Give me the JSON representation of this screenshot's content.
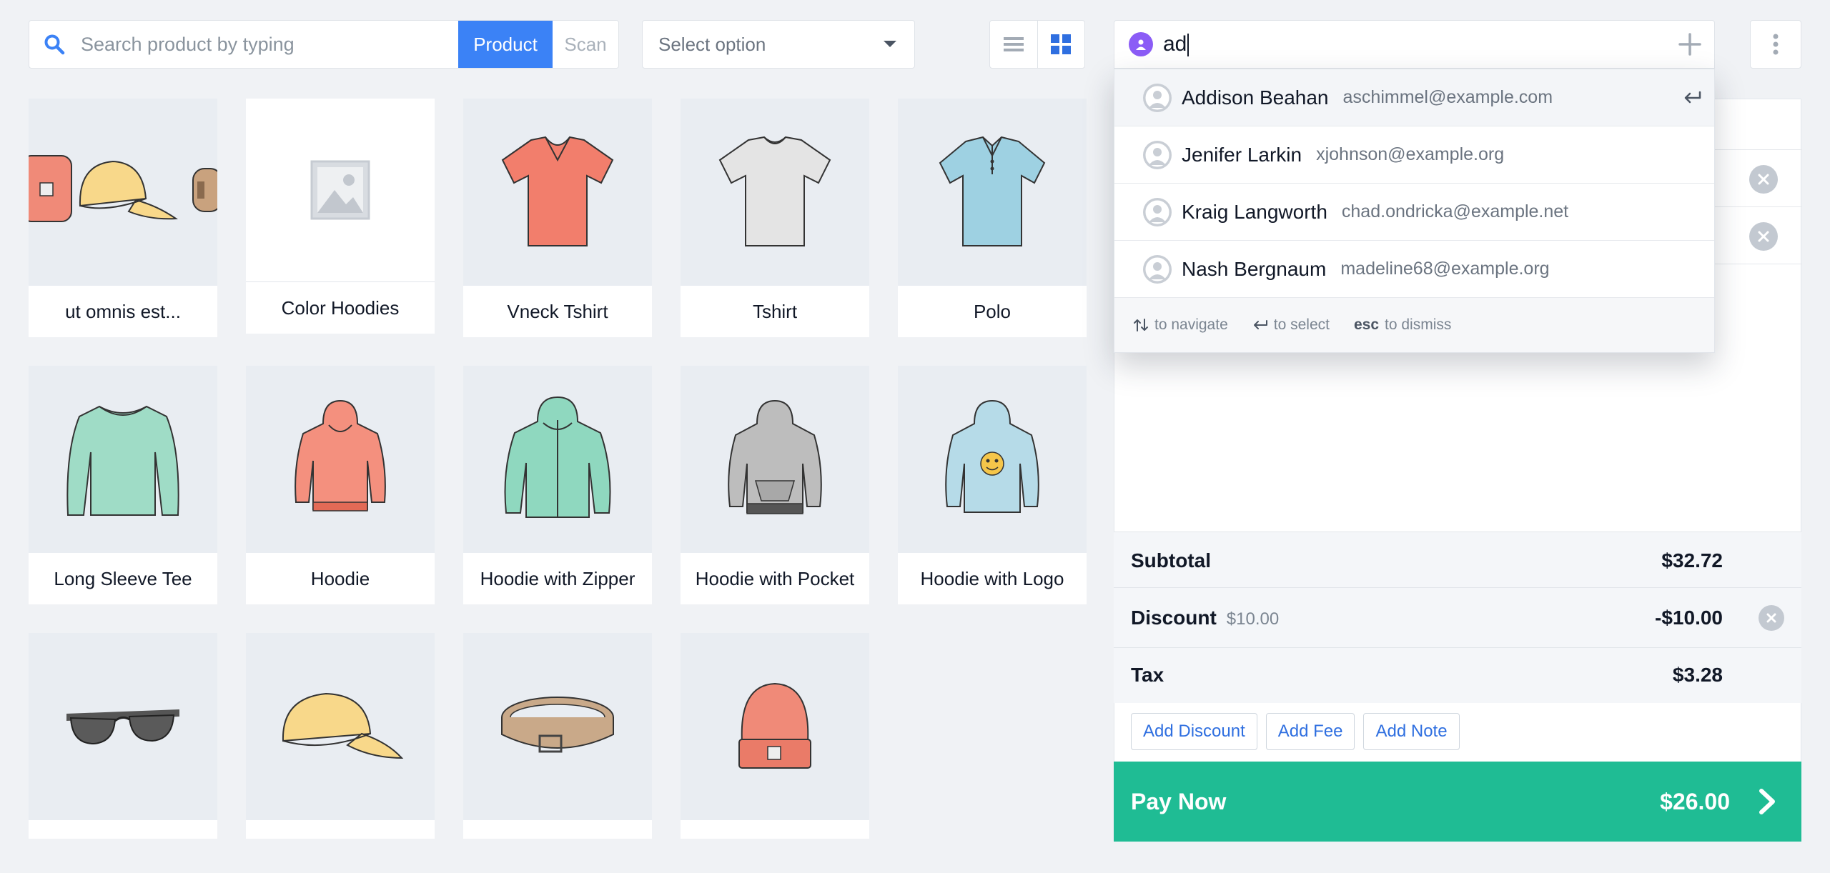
{
  "toolbar": {
    "search_placeholder": "Search product by typing",
    "product_label": "Product",
    "scan_label": "Scan",
    "select_label": "Select option"
  },
  "products": [
    {
      "name": "ut omnis est..."
    },
    {
      "name": "Color Hoodies"
    },
    {
      "name": "Vneck Tshirt"
    },
    {
      "name": "Tshirt"
    },
    {
      "name": "Polo"
    },
    {
      "name": "Long Sleeve Tee"
    },
    {
      "name": "Hoodie"
    },
    {
      "name": "Hoodie with Zipper"
    },
    {
      "name": "Hoodie with Pocket"
    },
    {
      "name": "Hoodie with Logo"
    },
    {
      "name": ""
    },
    {
      "name": ""
    },
    {
      "name": ""
    },
    {
      "name": ""
    }
  ],
  "customer": {
    "query": "ad"
  },
  "suggestions": [
    {
      "name": "Addison Beahan",
      "email": "aschimmel@example.com"
    },
    {
      "name": "Jenifer Larkin",
      "email": "xjohnson@example.org"
    },
    {
      "name": "Kraig Langworth",
      "email": "chad.ondricka@example.net"
    },
    {
      "name": "Nash Bergnaum",
      "email": "madeline68@example.org"
    }
  ],
  "dropdown_hints": {
    "navigate": "to navigate",
    "select": "to select",
    "esc_key": "esc",
    "dismiss": "to dismiss"
  },
  "totals": {
    "subtotal_label": "Subtotal",
    "subtotal_value": "$32.72",
    "discount_label": "Discount",
    "discount_sub": "$10.00",
    "discount_value": "-$10.00",
    "tax_label": "Tax",
    "tax_value": "$3.28"
  },
  "cart_actions": {
    "add_discount": "Add Discount",
    "add_fee": "Add Fee",
    "add_note": "Add Note"
  },
  "pay": {
    "label": "Pay Now",
    "amount": "$26.00"
  },
  "colors": {
    "accent": "#3b82f6",
    "pay": "#1fbc94",
    "avatar": "#8b5cf6"
  }
}
